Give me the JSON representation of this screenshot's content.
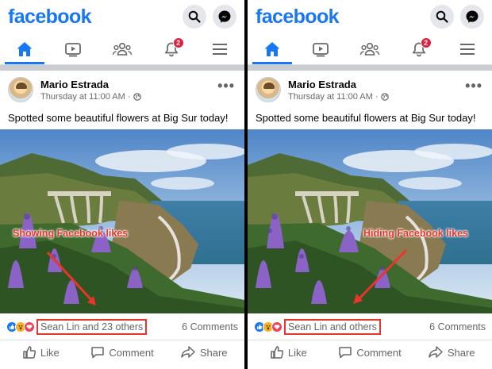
{
  "panels": [
    {
      "app": {
        "logo": "facebook"
      },
      "tabs": {
        "notification_count": "2"
      },
      "post": {
        "author": "Mario Estrada",
        "timestamp": "Thursday at 11:00 AM ·",
        "text": "Spotted some beautiful flowers at Big Sur today!",
        "annotation": "Showing Facebook likes",
        "likes_text": "Sean Lin and 23 others",
        "comments_text": "6 Comments",
        "actions": {
          "like": "Like",
          "comment": "Comment",
          "share": "Share"
        }
      }
    },
    {
      "app": {
        "logo": "facebook"
      },
      "tabs": {
        "notification_count": "2"
      },
      "post": {
        "author": "Mario Estrada",
        "timestamp": "Thursday at 11:00 AM ·",
        "text": "Spotted some beautiful flowers at Big Sur today!",
        "annotation": "Hiding Facebook likes",
        "likes_text": "Sean Lin and others",
        "comments_text": "6 Comments",
        "actions": {
          "like": "Like",
          "comment": "Comment",
          "share": "Share"
        }
      }
    }
  ],
  "colors": {
    "brand": "#1877f2",
    "annotation": "#e8362a",
    "badge": "#e41e3f"
  },
  "icons": [
    "search-icon",
    "messenger-icon",
    "home-icon",
    "watch-icon",
    "groups-icon",
    "bell-icon",
    "menu-icon",
    "globe-icon",
    "more-icon",
    "like-reaction-icon",
    "wow-reaction-icon",
    "love-reaction-icon",
    "thumbs-up-icon",
    "comment-icon",
    "share-icon"
  ]
}
